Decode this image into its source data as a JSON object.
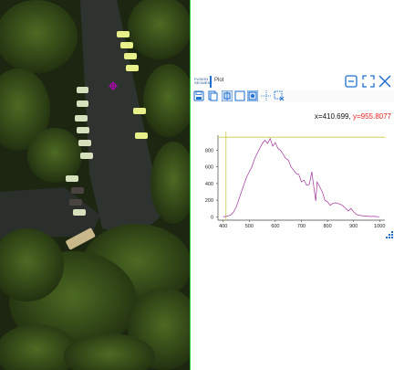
{
  "window": {
    "title": "Plot",
    "logo_line1": "FUSION",
    "logo_line2": "SEGMENT"
  },
  "toolbar": {
    "icons": [
      "save-icon",
      "copy-icon",
      "pan-icon",
      "zoom-box-icon",
      "zoom-fit-icon",
      "crosshair-icon",
      "clear-selection-icon"
    ]
  },
  "readout": {
    "x_label": "x=410.699,",
    "y_label": "y=955.8077"
  },
  "colors": {
    "line": "#a0329c",
    "crosshair": "#c9c84a",
    "accent": "#1f6fd1",
    "readout_y": "#e82020"
  },
  "chart_data": {
    "type": "line",
    "xlim": [
      380,
      1020
    ],
    "ylim": [
      -40,
      980
    ],
    "x_ticks": [
      400,
      500,
      600,
      700,
      800,
      900,
      1000
    ],
    "y_ticks": [
      0,
      200,
      400,
      600,
      800
    ],
    "crosshair": {
      "x": 410.699,
      "y": 955.8077
    },
    "series": [
      {
        "x": [
          400,
          410,
          420,
          430,
          440,
          450,
          460,
          470,
          480,
          490,
          500,
          510,
          520,
          530,
          540,
          550,
          560,
          570,
          580,
          590,
          600,
          610,
          620,
          630,
          640,
          650,
          660,
          670,
          680,
          690,
          700,
          710,
          720,
          730,
          740,
          750,
          755,
          760,
          770,
          780,
          790,
          800,
          810,
          820,
          830,
          840,
          850,
          860,
          870,
          880,
          890,
          900,
          910,
          920,
          930,
          940,
          950,
          960,
          970,
          980,
          990,
          1000
        ],
        "values": [
          0,
          5,
          12,
          25,
          60,
          120,
          210,
          300,
          390,
          480,
          540,
          600,
          690,
          760,
          820,
          880,
          920,
          880,
          940,
          850,
          890,
          820,
          800,
          750,
          700,
          680,
          600,
          560,
          520,
          510,
          420,
          440,
          380,
          390,
          540,
          300,
          190,
          420,
          360,
          300,
          200,
          180,
          140,
          160,
          170,
          160,
          150,
          130,
          100,
          70,
          100,
          60,
          30,
          20,
          15,
          10,
          8,
          5,
          5,
          5,
          3,
          2
        ]
      }
    ]
  }
}
